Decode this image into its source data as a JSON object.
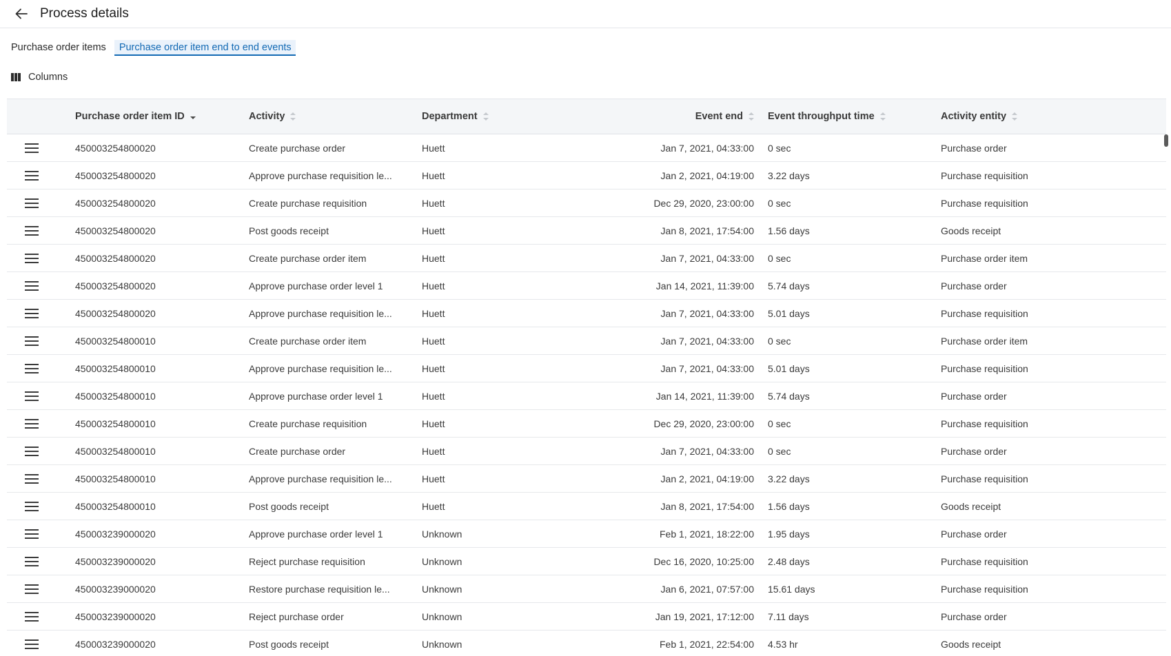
{
  "header": {
    "title": "Process details"
  },
  "tabs": [
    {
      "label": "Purchase order items",
      "active": false
    },
    {
      "label": "Purchase order item end to end events",
      "active": true
    }
  ],
  "toolbar": {
    "columns_label": "Columns"
  },
  "table": {
    "columns": [
      "Purchase order item ID",
      "Activity",
      "Department",
      "Event end",
      "Event throughput time",
      "Activity entity"
    ],
    "sorted_column": "Purchase order item ID",
    "sort_direction": "descending",
    "rows": [
      [
        "450003254800020",
        "Create purchase order",
        "Huett",
        "Jan 7, 2021, 04:33:00",
        "0 sec",
        "Purchase order"
      ],
      [
        "450003254800020",
        "Approve purchase requisition le...",
        "Huett",
        "Jan 2, 2021, 04:19:00",
        "3.22 days",
        "Purchase requisition"
      ],
      [
        "450003254800020",
        "Create purchase requisition",
        "Huett",
        "Dec 29, 2020, 23:00:00",
        "0 sec",
        "Purchase requisition"
      ],
      [
        "450003254800020",
        "Post goods receipt",
        "Huett",
        "Jan 8, 2021, 17:54:00",
        "1.56 days",
        "Goods receipt"
      ],
      [
        "450003254800020",
        "Create purchase order item",
        "Huett",
        "Jan 7, 2021, 04:33:00",
        "0 sec",
        "Purchase order item"
      ],
      [
        "450003254800020",
        "Approve purchase order level 1",
        "Huett",
        "Jan 14, 2021, 11:39:00",
        "5.74 days",
        "Purchase order"
      ],
      [
        "450003254800020",
        "Approve purchase requisition le...",
        "Huett",
        "Jan 7, 2021, 04:33:00",
        "5.01 days",
        "Purchase requisition"
      ],
      [
        "450003254800010",
        "Create purchase order item",
        "Huett",
        "Jan 7, 2021, 04:33:00",
        "0 sec",
        "Purchase order item"
      ],
      [
        "450003254800010",
        "Approve purchase requisition le...",
        "Huett",
        "Jan 7, 2021, 04:33:00",
        "5.01 days",
        "Purchase requisition"
      ],
      [
        "450003254800010",
        "Approve purchase order level 1",
        "Huett",
        "Jan 14, 2021, 11:39:00",
        "5.74 days",
        "Purchase order"
      ],
      [
        "450003254800010",
        "Create purchase requisition",
        "Huett",
        "Dec 29, 2020, 23:00:00",
        "0 sec",
        "Purchase requisition"
      ],
      [
        "450003254800010",
        "Create purchase order",
        "Huett",
        "Jan 7, 2021, 04:33:00",
        "0 sec",
        "Purchase order"
      ],
      [
        "450003254800010",
        "Approve purchase requisition le...",
        "Huett",
        "Jan 2, 2021, 04:19:00",
        "3.22 days",
        "Purchase requisition"
      ],
      [
        "450003254800010",
        "Post goods receipt",
        "Huett",
        "Jan 8, 2021, 17:54:00",
        "1.56 days",
        "Goods receipt"
      ],
      [
        "450003239000020",
        "Approve purchase order level 1",
        "Unknown",
        "Feb 1, 2021, 18:22:00",
        "1.95 days",
        "Purchase order"
      ],
      [
        "450003239000020",
        "Reject purchase requisition",
        "Unknown",
        "Dec 16, 2020, 10:25:00",
        "2.48 days",
        "Purchase requisition"
      ],
      [
        "450003239000020",
        "Restore purchase requisition le...",
        "Unknown",
        "Jan 6, 2021, 07:57:00",
        "15.61 days",
        "Purchase requisition"
      ],
      [
        "450003239000020",
        "Reject purchase order",
        "Unknown",
        "Jan 19, 2021, 17:12:00",
        "7.11 days",
        "Purchase order"
      ],
      [
        "450003239000020",
        "Post goods receipt",
        "Unknown",
        "Feb 1, 2021, 22:54:00",
        "4.53 hr",
        "Goods receipt"
      ]
    ]
  },
  "icons": {
    "back": "arrow-left-icon",
    "columns": "columns-icon",
    "row_menu": "hamburger-menu-icon",
    "sort": "sort-icon"
  },
  "colors": {
    "accent": "#1269b4",
    "header_bg": "#f4f6f8",
    "text": "#2c2c2c"
  }
}
